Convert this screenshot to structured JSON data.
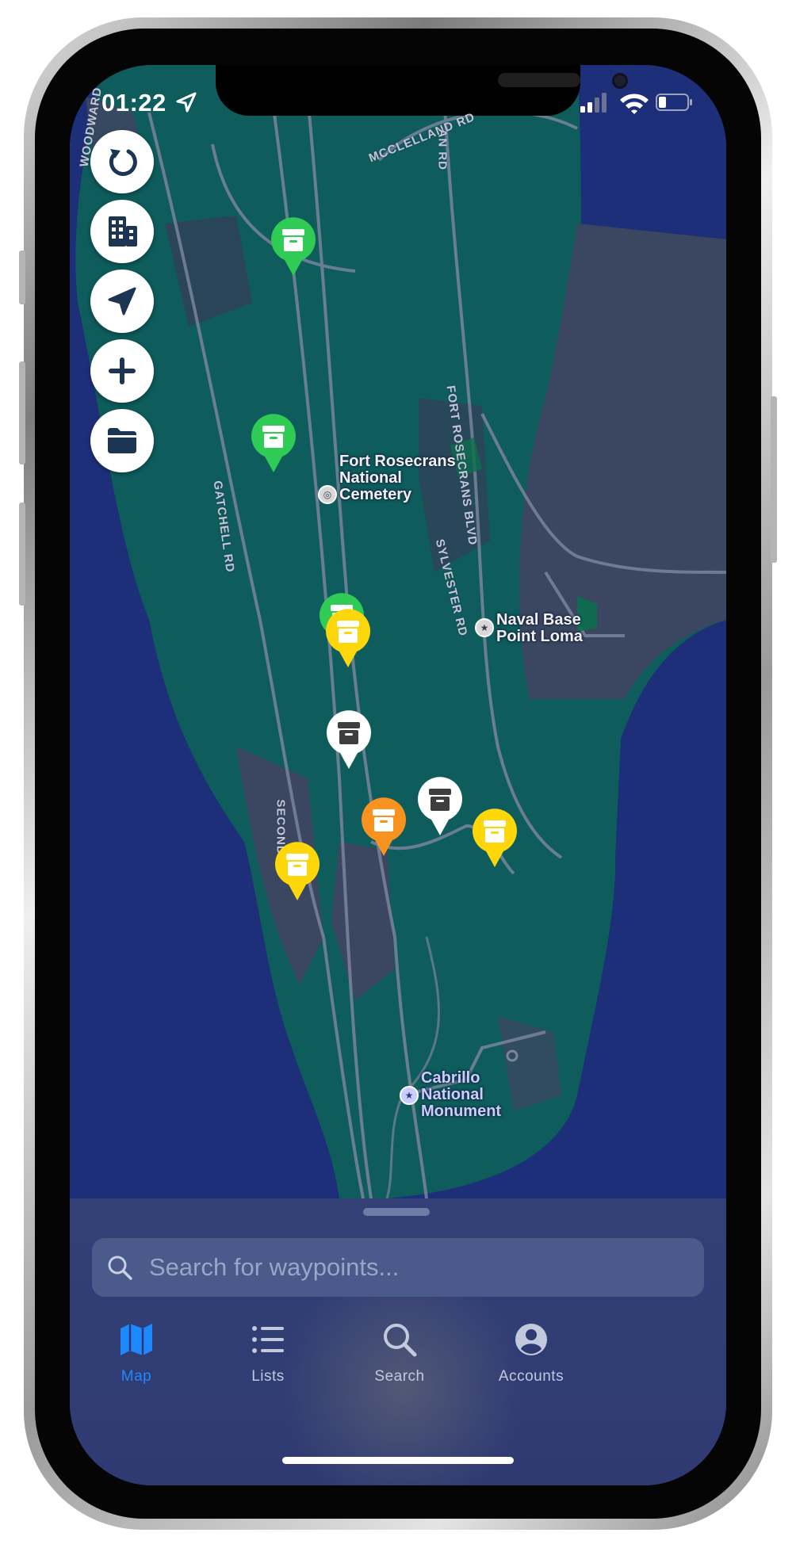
{
  "status_bar": {
    "time": "01:22"
  },
  "map": {
    "roads": {
      "woodward": "WOODWARD",
      "mcclelland": "MCCLELLAND RD",
      "top_right": "AN RD",
      "fort_rosecrans": "FORT ROSECRANS BLVD",
      "gatchell": "GATCHELL RD",
      "sylvester": "SYLVESTER RD",
      "second_st": "SECOND ST"
    },
    "places": {
      "cemetery_line1": "Fort Rosecrans",
      "cemetery_line2": "National",
      "cemetery_line3": "Cemetery",
      "naval_line1": "Naval Base",
      "naval_line2": "Point Loma",
      "cabrillo_line1": "Cabrillo",
      "cabrillo_line2": "National",
      "cabrillo_line3": "Monument"
    },
    "controls": [
      "refresh-icon",
      "buildings-icon",
      "location-arrow-icon",
      "plus-icon",
      "folder-icon"
    ],
    "waypoints": [
      {
        "status": "green",
        "icon": "cache-box-icon"
      },
      {
        "status": "green",
        "icon": "cache-box-icon"
      },
      {
        "status": "green",
        "icon": "cache-box-icon"
      },
      {
        "status": "yellow",
        "icon": "cache-box-icon"
      },
      {
        "status": "white",
        "icon": "cache-box-icon"
      },
      {
        "status": "white",
        "icon": "cache-box-icon"
      },
      {
        "status": "orange",
        "icon": "cache-box-icon"
      },
      {
        "status": "yellow",
        "icon": "cache-box-icon"
      },
      {
        "status": "yellow",
        "icon": "cache-box-icon"
      }
    ]
  },
  "search": {
    "placeholder": "Search for waypoints..."
  },
  "tabs": [
    {
      "label": "Map",
      "icon": "map-icon",
      "active": true
    },
    {
      "label": "Lists",
      "icon": "list-icon",
      "active": false
    },
    {
      "label": "Search",
      "icon": "magnifier-icon",
      "active": false
    },
    {
      "label": "Accounts",
      "icon": "account-icon",
      "active": false
    }
  ],
  "colors": {
    "water": "#1e2f7a",
    "park": "#0e5c5c",
    "land": "#3b4760",
    "active_tab": "#1e88ff",
    "inactive_tab": "#c3c9dc",
    "pin_green": "#2fcb55",
    "pin_yellow": "#fed70a",
    "pin_orange": "#f7931e",
    "pin_white": "#ffffff"
  }
}
